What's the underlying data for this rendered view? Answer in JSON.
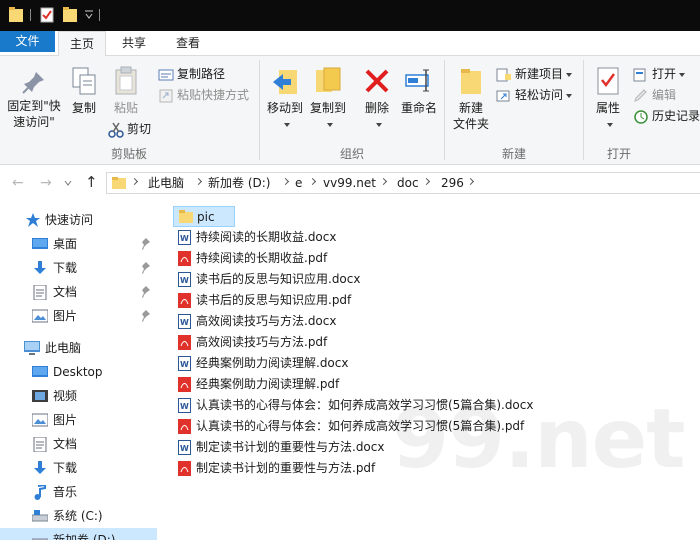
{
  "menu": {
    "tabs": [
      "文件",
      "主页",
      "共享",
      "查看"
    ]
  },
  "ribbon": {
    "clipboard": {
      "pin_label_1": "固定到\"快",
      "pin_label_2": "速访问\"",
      "copy": "复制",
      "paste": "粘贴",
      "copy_path": "复制路径",
      "paste_shortcut": "粘贴快捷方式",
      "cut": "剪切",
      "group": "剪贴板"
    },
    "organize": {
      "move_to": "移动到",
      "copy_to": "复制到",
      "delete": "删除",
      "rename": "重命名",
      "group": "组织"
    },
    "new": {
      "new_folder_1": "新建",
      "new_folder_2": "文件夹",
      "new_item": "新建项目",
      "easy_access": "轻松访问",
      "group": "新建"
    },
    "open": {
      "properties": "属性",
      "open": "打开",
      "edit": "编辑",
      "history": "历史记录",
      "group": "打开"
    }
  },
  "address": {
    "crumbs": [
      "此电脑",
      "新加卷 (D:)",
      "e",
      "vv99.net",
      "doc",
      "296"
    ]
  },
  "navpane": {
    "quick_access": "快速访问",
    "qa_items": [
      "桌面",
      "下载",
      "文档",
      "图片"
    ],
    "this_pc": "此电脑",
    "pc_items": [
      "Desktop",
      "视频",
      "图片",
      "文档",
      "下载",
      "音乐",
      "系统 (C:)",
      "新加卷 (D:)"
    ]
  },
  "files": [
    {
      "name": "pic",
      "type": "folder"
    },
    {
      "name": "持续阅读的长期收益.docx",
      "type": "docx"
    },
    {
      "name": "持续阅读的长期收益.pdf",
      "type": "pdf"
    },
    {
      "name": "读书后的反思与知识应用.docx",
      "type": "docx"
    },
    {
      "name": "读书后的反思与知识应用.pdf",
      "type": "pdf"
    },
    {
      "name": "高效阅读技巧与方法.docx",
      "type": "docx"
    },
    {
      "name": "高效阅读技巧与方法.pdf",
      "type": "pdf"
    },
    {
      "name": "经典案例助力阅读理解.docx",
      "type": "docx"
    },
    {
      "name": "经典案例助力阅读理解.pdf",
      "type": "pdf"
    },
    {
      "name": "认真读书的心得与体会：如何养成高效学习习惯(5篇合集).docx",
      "type": "docx"
    },
    {
      "name": "认真读书的心得与体会：如何养成高效学习习惯(5篇合集).pdf",
      "type": "pdf"
    },
    {
      "name": "制定读书计划的重要性与方法.docx",
      "type": "docx"
    },
    {
      "name": "制定读书计划的重要性与方法.pdf",
      "type": "pdf"
    }
  ],
  "watermark": "99.net",
  "colors": {
    "accent": "#1979ca",
    "selection": "#cce8ff",
    "folder": "#f8d775",
    "pdf": "#e0312b",
    "docx": "#2b5797"
  }
}
